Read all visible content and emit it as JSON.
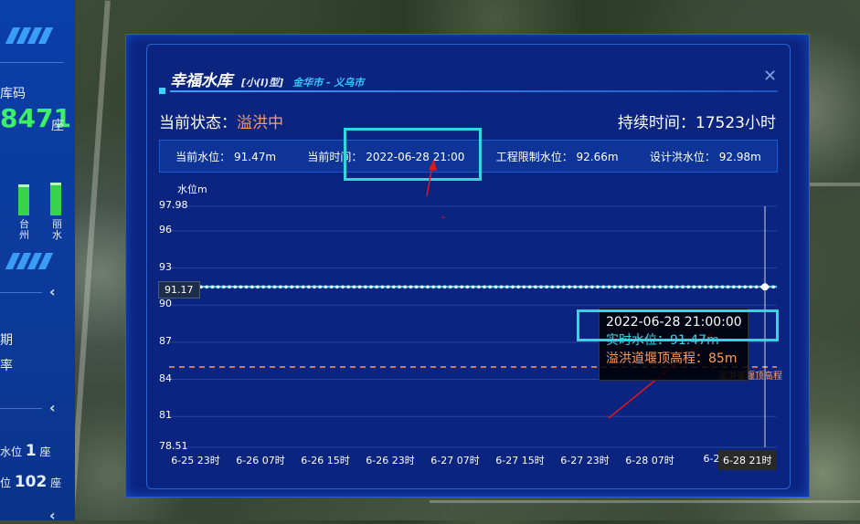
{
  "left_panel": {
    "top_label": "库码",
    "count_value": "8471",
    "count_unit": "座",
    "bar_labels": [
      "台州",
      "丽水"
    ],
    "period_label": "期",
    "period_sub": "率",
    "row1_label": "水位",
    "row1_value": "1",
    "row1_unit": "座",
    "row2_label": "位",
    "row2_value": "102",
    "row2_unit": "座"
  },
  "dialog": {
    "title": "幸福水库",
    "type": "[小(I)型]",
    "city": "金华市 - 义乌市",
    "status_label": "当前状态：",
    "status_value": "溢洪中",
    "duration": "持续时间：17523小时",
    "info": [
      "当前水位： 91.47m",
      "当前时间： 2022-06-28 21:00",
      "工程限制水位： 92.66m",
      "设计洪水位： 92.98m"
    ]
  },
  "chart_data": {
    "type": "line",
    "ylabel": "水位m",
    "ylim": [
      78.51,
      97.98
    ],
    "y_ticks": [
      "97.98",
      "96",
      "93",
      "90",
      "87",
      "84",
      "81",
      "78.51"
    ],
    "x_ticks": [
      "6-25 23时",
      "6-26 07时",
      "6-26 15时",
      "6-26 23时",
      "6-27 07时",
      "6-27 15时",
      "6-27 23时",
      "6-28 07时",
      "6-28"
    ],
    "series": [
      {
        "name": "实时水位",
        "values": [
          91.47
        ],
        "constant": true,
        "color": "#36d6e0"
      },
      {
        "name": "溢洪道堰顶高程",
        "values": [
          85
        ],
        "constant": true,
        "color": "#ff9c5a"
      }
    ],
    "hover_x_label": "6-28 21时",
    "hover_y_label": "91.17",
    "threshold_label": "溢洪道堰顶高程",
    "tooltip": {
      "time": "2022-06-28 21:00:00",
      "level": "实时水位：91.47m",
      "crest": "溢洪道堰顶高程：85m"
    }
  }
}
